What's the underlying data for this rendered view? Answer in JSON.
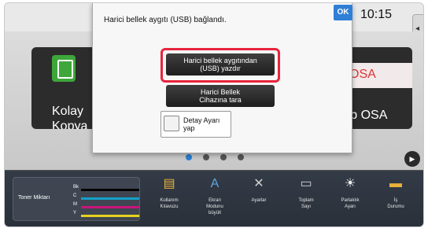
{
  "status": {
    "time": "10:15",
    "side_tab_glyph": "◂"
  },
  "dialog": {
    "message": "Harici bellek aygıtı (USB) bağlandı.",
    "ok_label": "OK",
    "buttons": [
      {
        "line1": "Harici bellek aygıtından",
        "line2": "(USB) yazdır"
      },
      {
        "line1": "Harici Bellek",
        "line2": "Cihazına tara"
      }
    ],
    "detail_checkbox": {
      "line1": "Detay Ayarı",
      "line2": "yap",
      "checked": false
    }
  },
  "home": {
    "tiles": [
      {
        "line1": "Kolay",
        "line2": "Kopya",
        "icon": "copy-icon"
      },
      {
        "label": "arp OSA",
        "banner": "OSA",
        "icon": "sharp-osa-icon"
      }
    ],
    "page_dots": 4,
    "active_dot": 0,
    "next_glyph": "▶"
  },
  "bottom_bar": {
    "toner_label": "Toner Miktarı",
    "toner": [
      {
        "label": "Bk",
        "color": "#000000"
      },
      {
        "label": "C",
        "color": "#14a0c8"
      },
      {
        "label": "M",
        "color": "#c8147a"
      },
      {
        "label": "Y",
        "color": "#e6d21e"
      }
    ],
    "items": [
      {
        "line1": "Kullanım",
        "line2": "Kılavuzu",
        "line3": "",
        "icon": "manual-icon"
      },
      {
        "line1": "Ekran",
        "line2": "Modunu",
        "line3": "büyült",
        "icon": "enlarge-icon"
      },
      {
        "line1": "Ayarlar",
        "line2": "",
        "line3": "",
        "icon": "settings-icon"
      },
      {
        "line1": "Toplam",
        "line2": "Sayı",
        "line3": "",
        "icon": "counter-icon"
      },
      {
        "line1": "Parlaklık",
        "line2": "Ayarı",
        "line3": "",
        "icon": "brightness-icon"
      },
      {
        "line1": "İş",
        "line2": "Durumu",
        "line3": "",
        "icon": "job-status-icon"
      }
    ]
  }
}
